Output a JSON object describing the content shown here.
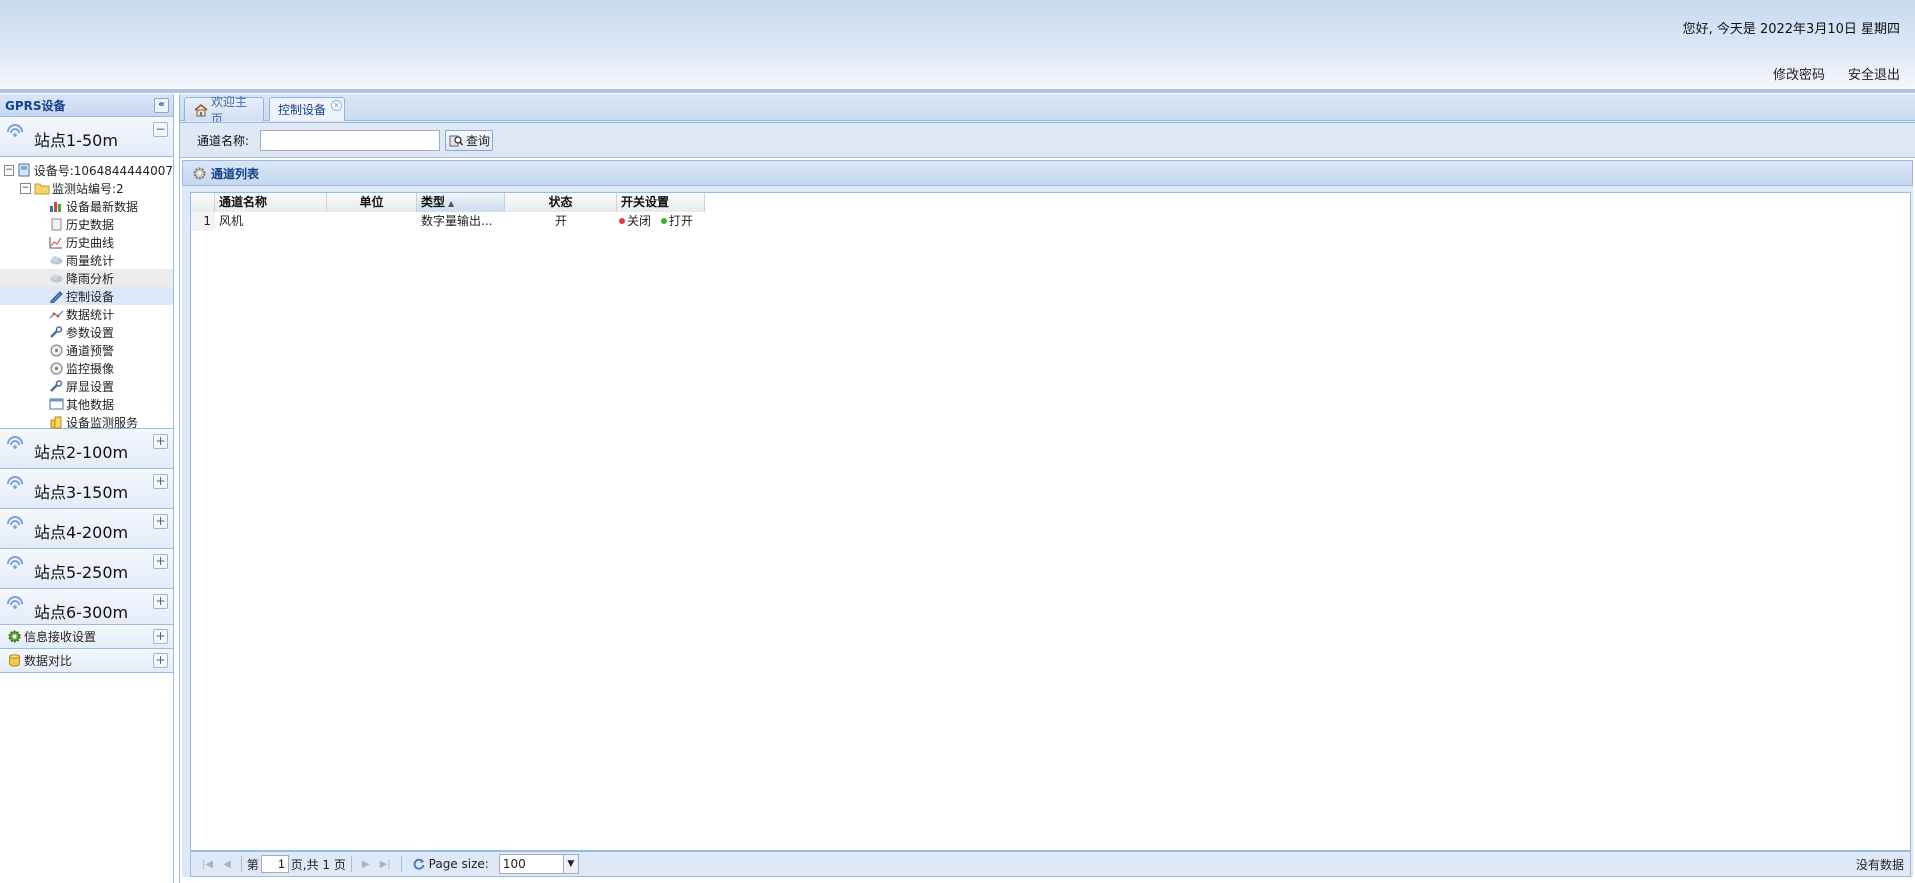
{
  "header": {
    "greeting": "您好, 今天是 2022年3月10日 星期四",
    "change_password": "修改密码",
    "logout": "安全退出"
  },
  "sidebar": {
    "title": "GPRS设备",
    "collapse_icon": "double-chevron-left-icon",
    "stations": [
      {
        "label": "站点1-50m",
        "expanded": true
      },
      {
        "label": "站点2-100m",
        "expanded": false
      },
      {
        "label": "站点3-150m",
        "expanded": false
      },
      {
        "label": "站点4-200m",
        "expanded": false
      },
      {
        "label": "站点5-250m",
        "expanded": false
      },
      {
        "label": "站点6-300m",
        "expanded": false
      }
    ],
    "tree": {
      "device": "设备号:1064844444007",
      "station": "监测站编号:2",
      "leaves": [
        {
          "label": "设备最新数据",
          "icon": "bar-chart-icon"
        },
        {
          "label": "历史数据",
          "icon": "document-icon"
        },
        {
          "label": "历史曲线",
          "icon": "line-chart-icon"
        },
        {
          "label": "雨量统计",
          "icon": "cloud-icon"
        },
        {
          "label": "降雨分析",
          "icon": "cloud-icon"
        },
        {
          "label": "控制设备",
          "icon": "pen-icon"
        },
        {
          "label": "数据统计",
          "icon": "scatter-icon"
        },
        {
          "label": "参数设置",
          "icon": "wrench-icon"
        },
        {
          "label": "通道预警",
          "icon": "disc-icon"
        },
        {
          "label": "监控摄像",
          "icon": "disc-icon"
        },
        {
          "label": "屏显设置",
          "icon": "wrench-icon"
        },
        {
          "label": "其他数据",
          "icon": "window-icon"
        },
        {
          "label": "设备监测服务",
          "icon": "server-icon"
        }
      ]
    },
    "groups": [
      {
        "label": "信息接收设置",
        "icon": "gear-icon"
      },
      {
        "label": "数据对比",
        "icon": "database-icon"
      }
    ]
  },
  "tabs": [
    {
      "label": "欢迎主页",
      "icon": "home-icon"
    },
    {
      "label": "控制设备",
      "active": true
    }
  ],
  "search": {
    "label": "通道名称:",
    "value": "",
    "button": "查询"
  },
  "panel": {
    "title": "通道列表"
  },
  "grid": {
    "columns": [
      "通道名称",
      "单位",
      "类型",
      "状态",
      "开关设置"
    ],
    "rows": [
      {
        "num": "1",
        "name": "风机",
        "unit": "",
        "type": "数字量输出...",
        "status": "开",
        "off": "关闭",
        "on": "打开"
      }
    ]
  },
  "pager": {
    "page_prefix": "第",
    "page": "1",
    "page_suffix": "页,共 1 页",
    "page_size_label": "Page size:",
    "page_size": "100",
    "empty_text": "没有数据"
  },
  "colors": {
    "off_dot": "#e0393e",
    "on_dot": "#3fae2a",
    "accent": "#15428b"
  }
}
